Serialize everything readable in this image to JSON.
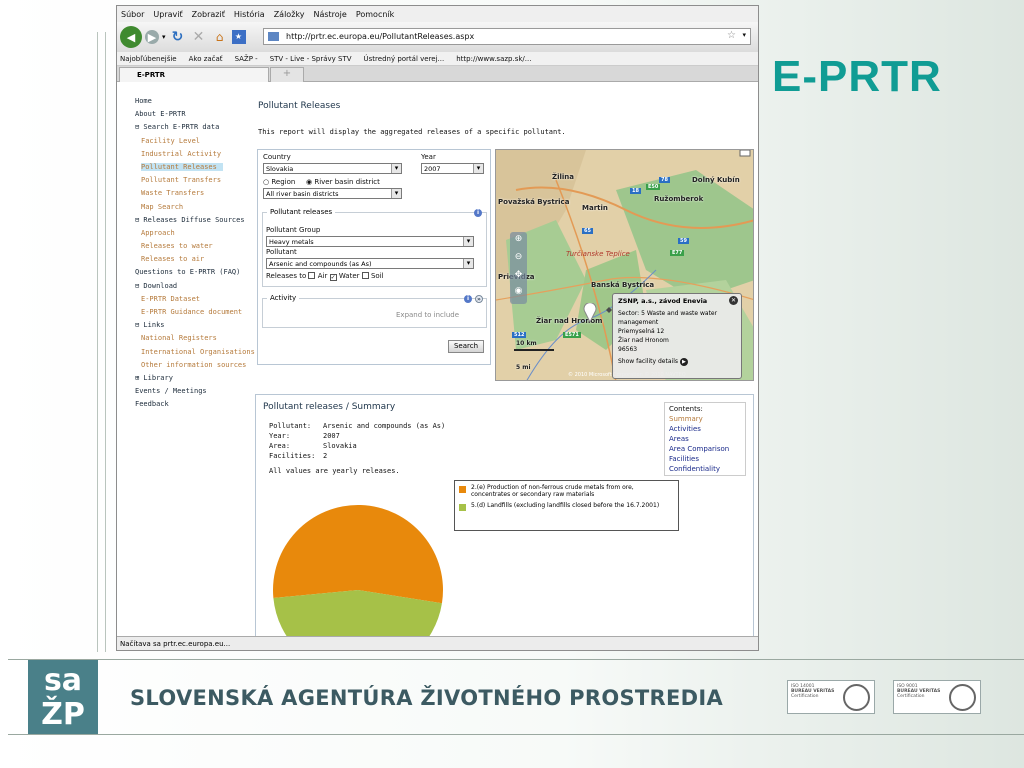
{
  "slide": {
    "title": "E-PRTR",
    "footer": "SLOVENSKÁ AGENTÚRA ŽIVOTNÉHO PROSTREDIA",
    "logo_top": "sa",
    "logo_bottom": "ŽP"
  },
  "browser": {
    "menu": [
      "Súbor",
      "Upraviť",
      "Zobraziť",
      "História",
      "Záložky",
      "Nástroje",
      "Pomocník"
    ],
    "url": "http://prtr.ec.europa.eu/PollutantReleases.aspx",
    "bookmarks": [
      "Najobľúbenejšie",
      "Ako začať",
      "SAŽP -",
      "STV - Live - Správy STV",
      "Ústredný portál verej...",
      "http://www.sazp.sk/..."
    ],
    "tab": "E-PRTR",
    "status": "Načítava sa prtr.ec.europa.eu..."
  },
  "nav": {
    "items": [
      {
        "label": "Home",
        "sub": false
      },
      {
        "label": "About E-PRTR",
        "sub": false
      },
      {
        "label": "⊟ Search E-PRTR data",
        "sub": false
      },
      {
        "label": "Facility Level",
        "sub": true
      },
      {
        "label": "Industrial Activity",
        "sub": true
      },
      {
        "label": "Pollutant Releases",
        "sub": true
      },
      {
        "label": "Pollutant Transfers",
        "sub": true
      },
      {
        "label": "Waste Transfers",
        "sub": true
      },
      {
        "label": "Map Search",
        "sub": true
      },
      {
        "label": "⊟ Releases Diffuse Sources",
        "sub": false
      },
      {
        "label": "Approach",
        "sub": true
      },
      {
        "label": "Releases to water",
        "sub": true
      },
      {
        "label": "Releases to air",
        "sub": true
      },
      {
        "label": "Questions to E-PRTR (FAQ)",
        "sub": false
      },
      {
        "label": "⊟ Download",
        "sub": false
      },
      {
        "label": "E-PRTR Dataset",
        "sub": true
      },
      {
        "label": "E-PRTR Guidance document",
        "sub": true
      },
      {
        "label": "⊟ Links",
        "sub": false
      },
      {
        "label": "National Registers",
        "sub": true
      },
      {
        "label": "International Organisations",
        "sub": true
      },
      {
        "label": "Other information sources",
        "sub": true
      },
      {
        "label": "⊞ Library",
        "sub": false
      },
      {
        "label": "Events / Meetings",
        "sub": false
      },
      {
        "label": "Feedback",
        "sub": false
      }
    ]
  },
  "page": {
    "title": "Pollutant Releases",
    "description": "This report will display the aggregated releases of a specific pollutant."
  },
  "form": {
    "country_label": "Country",
    "country": "Slovakia",
    "year_label": "Year",
    "year": "2007",
    "region_label": "Region",
    "river_label": "River basin district",
    "district": "All river basin districts",
    "pollutant_releases": "Pollutant releases",
    "group_label": "Pollutant Group",
    "group": "Heavy metals",
    "pollutant_label": "Pollutant",
    "pollutant": "Arsenic and compounds (as As)",
    "releases_to": "Releases to",
    "air": "Air",
    "water": "Water",
    "soil": "Soil",
    "activity": "Activity",
    "expand": "Expand to include",
    "search": "Search"
  },
  "map": {
    "places": [
      "Žilina",
      "Dolný Kubín",
      "Ružomberok",
      "Martin",
      "Banská Bystrica",
      "Žiar nad Hronom",
      "Prievidza",
      "Turčianske Teplice",
      "Považská Bystrica"
    ],
    "scale_km": "10 km",
    "scale_mi": "5 mi",
    "copyright": "© 2010 Microsoft Corporation © 2010 NAVTEQ",
    "popup": {
      "title": "ZSNP, a.s., závod Enevia",
      "sector": "Sector: 5 Waste and waste water management",
      "street": "Priemyselná 12",
      "city": "Žiar nad Hronom",
      "zip": "96563",
      "link": "Show facility details"
    }
  },
  "summary": {
    "title": "Pollutant releases / Summary",
    "pollutant_label": "Pollutant:",
    "pollutant": "Arsenic and compounds (as As)",
    "year_label": "Year:",
    "year": "2007",
    "area_label": "Area:",
    "area": "Slovakia",
    "facilities_label": "Facilities:",
    "facilities": "2",
    "note": "All values are yearly releases.",
    "contents_title": "Contents:",
    "contents": [
      "Summary",
      "Activities",
      "Areas",
      "Area Comparison",
      "Facilities",
      "Confidentiality"
    ]
  },
  "chart_data": {
    "type": "pie",
    "categories": [
      "2.(e) Production of non-ferrous crude metals from ore, concentrates or secondary raw materials",
      "5.(d) Landfills (excluding landfills closed before the 16.7.2001)"
    ],
    "values": [
      54,
      46
    ],
    "colors": [
      "#e8890c",
      "#a6c148"
    ]
  },
  "certs": [
    {
      "line1": "ISO 14001",
      "line2": "BUREAU VERITAS",
      "line3": "Certification"
    },
    {
      "line1": "ISO 9001",
      "line2": "BUREAU VERITAS",
      "line3": "Certification"
    }
  ]
}
